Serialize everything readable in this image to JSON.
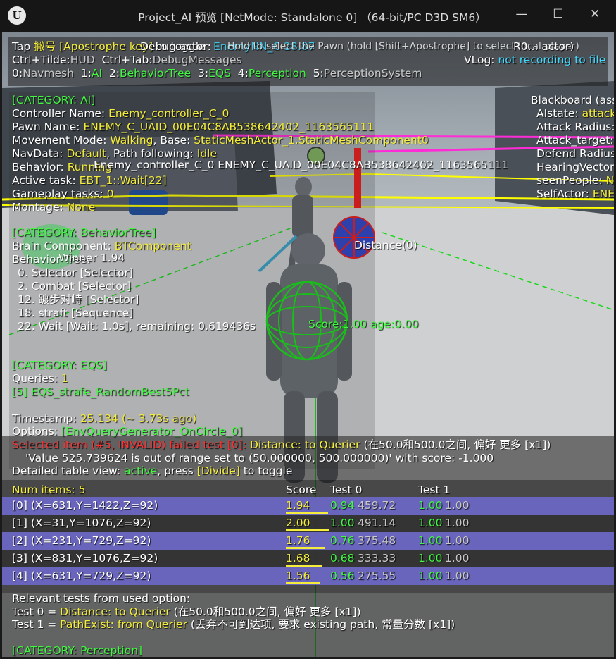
{
  "window": {
    "logo": "U",
    "title": "Project_AI 预览 [NetMode: Standalone 0] （64-bit/PC D3D SM6）",
    "minimize_glyph": "—",
    "maximize_glyph": "☐",
    "close_glyph": "✕"
  },
  "hud_top": {
    "tap_key": "Tap",
    "key_name": "撇号 [Apostrophe key]",
    "toggle": "to toggle",
    "debug_actor": "Debug actor:",
    "hold_msg": "Hold to select the Pawn (hold [Shift+Apostrophe] to select local player)",
    "overlap_cyan": "EnemyNN_C 28.87",
    "overlap_white": "R0... actor)",
    "line2_a": "Ctrl+Tilde:",
    "line2_b": "HUD",
    "line2_c": "Ctrl+Tab:",
    "line2_d": "DebugMessages",
    "vlog_label": "VLog:",
    "vlog_value": "not recording to file",
    "cat_nums": [
      "0:",
      "1:",
      "2:",
      "3:",
      "4:",
      "5:"
    ],
    "cat_names": [
      "Navmesh",
      "AI",
      "BehaviorTree",
      "EQS",
      "Perception",
      "PerceptionSystem"
    ]
  },
  "ai": {
    "header": "[CATEGORY: AI]",
    "controller_label": "Controller Name:",
    "controller_value": "Enemy_controller_C_0",
    "pawn_label": "Pawn Name:",
    "pawn_value": "ENEMY_C_UAID_00E04C8AB538642402_1163565111",
    "movement_label": "Movement Mode:",
    "movement_value": "Walking",
    "base_label": ", Base:",
    "base_value": "StaticMeshActor_1.StaticMeshComponent0",
    "navdata_label": "NavData:",
    "navdata_value": "Default",
    "path_label": ", Path following:",
    "path_value": "Idle",
    "behavior_label": "Behavior:",
    "behavior_value": "Running",
    "active_task_label": "Active task:",
    "active_task_value": "EBT_1::Wait[22]",
    "gameplay_label": "Gameplay tasks:",
    "gameplay_value": "0",
    "montage_label": "Montage:",
    "montage_value": "None",
    "world_label": "Enemy_controller_C_0 ENEMY_C_UAID_00E04C8AB538642402_1163565111"
  },
  "bt": {
    "header": "[CATEGORY: BehaviorTree]",
    "brain_label": "Brain Component:",
    "brain_value": "BTComponent",
    "tree_label": "Behavior Tree:",
    "nodes": [
      "0. Selector [Selector]",
      "2. Combat [Selector]",
      "12. 踱步对峙 [Selector]",
      "18. straft [Sequence]",
      "22. Wait [Wait: 1.0s], remaining: 0.619436s"
    ]
  },
  "world": {
    "winner": "Winner 1.94",
    "distance": "Distance(0)",
    "score_age": "Score:1.00 age:0.00"
  },
  "blackboard": {
    "title": "Blackboard (ass",
    "keys": [
      "AIstate:",
      "Attack Radius:",
      "Attack_target:",
      "Defend Radius",
      "HearingVector",
      "seenPeople:",
      "SelfActor:"
    ],
    "vals": [
      "attack",
      "",
      "",
      "",
      "",
      "N",
      "ENE"
    ]
  },
  "eqs": {
    "header": "[CATEGORY: EQS]",
    "queries_label": "Queries:",
    "queries_value": "1",
    "query_name": "[5] EQS_strafe_RandomBest5Pct",
    "timestamp_label": "Timestamp:",
    "timestamp_value": "25.134 (~ 3.73s ago)",
    "options_label": "Options:",
    "options_value": "[EnvQueryGenerator_OnCircle_0]",
    "selected_red": "Selected item (#5, INVALID) failed test [0]:",
    "selected_yellow": "Distance: to Querier",
    "selected_gray": "(在50.0和500.0之间, 偏好 更多 [x1])",
    "value_msg": "'Value 525.739624 is out of range set to (50.000000, 500.000000)' with score: -1.000",
    "detailed_label": "Detailed table view:",
    "detailed_value": "active",
    "press_label": ", press",
    "press_key": "[Divide]",
    "press_tail": "to toggle"
  },
  "table": {
    "num_items": "Num items: 5",
    "col_score": "Score",
    "col_test0": "Test 0",
    "col_test1": "Test 1",
    "rows": [
      {
        "item": "[0] (X=631,Y=1422,Z=92)",
        "score": "1.94",
        "t0_norm": "0.94",
        "t0_raw": "459.72",
        "t1_norm": "1.00",
        "t1_raw": "1.00"
      },
      {
        "item": "[1] (X=31,Y=1076,Z=92)",
        "score": "2.00",
        "t0_norm": "1.00",
        "t0_raw": "491.14",
        "t1_norm": "1.00",
        "t1_raw": "1.00"
      },
      {
        "item": "[2] (X=231,Y=729,Z=92)",
        "score": "1.76",
        "t0_norm": "0.76",
        "t0_raw": "375.48",
        "t1_norm": "1.00",
        "t1_raw": "1.00"
      },
      {
        "item": "[3] (X=831,Y=1076,Z=92)",
        "score": "1.68",
        "t0_norm": "0.68",
        "t0_raw": "333.33",
        "t1_norm": "1.00",
        "t1_raw": "1.00"
      },
      {
        "item": "[4] (X=631,Y=729,Z=92)",
        "score": "1.56",
        "t0_norm": "0.56",
        "t0_raw": "275.55",
        "t1_norm": "1.00",
        "t1_raw": "1.00"
      }
    ],
    "score_fractions": [
      0.97,
      1.0,
      0.88,
      0.84,
      0.78
    ]
  },
  "relevant": {
    "header": "Relevant tests from used option:",
    "test0_label": "Test 0 =",
    "test0_name": "Distance: to Querier",
    "test0_desc": "(在50.0和500.0之间, 偏好 更多 [x1])",
    "test1_label": "Test 1 =",
    "test1_name": "PathExist: from Querier",
    "test1_desc": "(丢弃不可到达项, 要求 existing path, 常量分数 [x1])"
  },
  "perception": {
    "header": "[CATEGORY: Perception]"
  },
  "colors": {
    "hud_yellow": "#f4ed3c",
    "hud_green": "#42f842",
    "hud_red": "#ff3030",
    "row_highlight": "#6c68c8"
  }
}
